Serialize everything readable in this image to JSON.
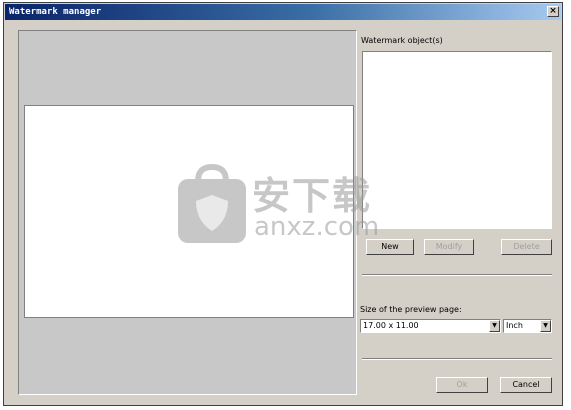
{
  "window": {
    "title": "Watermark manager",
    "close_glyph": "×"
  },
  "preview": {
    "label": ""
  },
  "objects": {
    "label": "Watermark object(s)",
    "items": []
  },
  "buttons": {
    "new": "New",
    "modify": "Modify",
    "delete": "Delete",
    "ok": "Ok",
    "cancel": "Cancel"
  },
  "page_size": {
    "label": "Size of the preview page:",
    "size_value": "17.00 x 11.00",
    "unit_value": "Inch",
    "dropdown_glyph": "▼"
  },
  "watermark_overlay": {
    "logo_icon": "shopping-bag-shield-icon",
    "chinese_text": "安下载",
    "latin_text": "anxz.com"
  },
  "colors": {
    "dialog_bg": "#d4d0c8",
    "title_start": "#0a246a",
    "title_end": "#a6caf0",
    "preview_bg": "#c8c8c8"
  }
}
